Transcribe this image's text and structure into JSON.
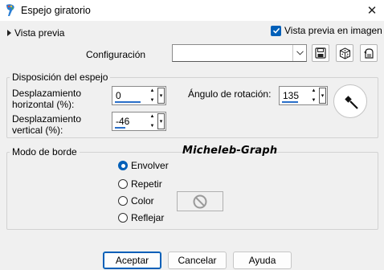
{
  "window": {
    "title": "Espejo giratorio",
    "app_icon": "paintshop-palette-icon",
    "close_symbol": "✕"
  },
  "preview": {
    "expander_label": "Vista previa",
    "image_preview_label": "Vista previa en imagen",
    "image_preview_checked": true
  },
  "config": {
    "label": "Configuración",
    "value": "",
    "tools": [
      "save-preset-icon",
      "randomize-dice-icon",
      "reset-defaults-icon"
    ]
  },
  "mirror_group": {
    "legend": "Disposición del espejo",
    "horizontal_label": "Desplazamiento horizontal (%):",
    "horizontal_value": "0",
    "vertical_label": "Desplazamiento vertical (%):",
    "vertical_value": "-46",
    "rotation_label": "Ángulo de rotación:",
    "rotation_value": "135",
    "rotation_degrees": 135
  },
  "border_group": {
    "legend": "Modo de borde",
    "options": [
      {
        "label": "Envolver",
        "checked": true
      },
      {
        "label": "Repetir",
        "checked": false
      },
      {
        "label": "Color",
        "checked": false
      },
      {
        "label": "Reflejar",
        "checked": false
      }
    ]
  },
  "watermark": "Micheleb-Graph",
  "buttons": {
    "ok": "Aceptar",
    "cancel": "Cancelar",
    "help": "Ayuda"
  },
  "colors": {
    "accent": "#005fb8",
    "spin_underline": "#2a6fc9"
  }
}
